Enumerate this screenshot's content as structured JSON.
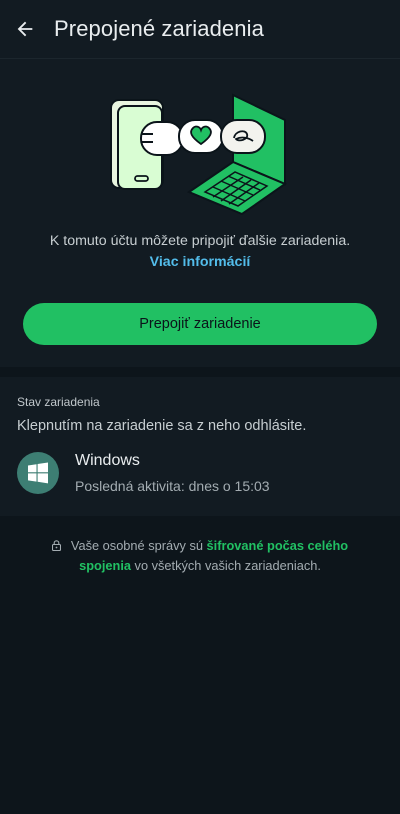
{
  "header": {
    "title": "Prepojené zariadenia",
    "back_icon": "arrow-left-icon"
  },
  "hero": {
    "intro_text": "K tomuto účtu môžete pripojiť ďalšie zariadenia.",
    "more_info_link": "Viac informácií",
    "illustration_icon": "phone-laptop-link-illustration",
    "primary_button": "Prepojiť zariadenie"
  },
  "devices": {
    "section_label": "Stav zariadenia",
    "hint": "Klepnutím na zariadenie sa z neho odhlásite.",
    "items": [
      {
        "name": "Windows",
        "status": "Posledná aktivita: dnes o 15:03",
        "icon": "windows-icon"
      }
    ]
  },
  "footer": {
    "lock_icon": "lock-icon",
    "text_before": "Vaše osobné správy sú ",
    "link_text": "šifrované počas celého spojenia",
    "text_after": " vo všetkých vašich zariadeniach."
  },
  "colors": {
    "background": "#121b22",
    "accent_green": "#21c063",
    "link_blue": "#53bdeb",
    "avatar_teal": "#3d7e73"
  }
}
